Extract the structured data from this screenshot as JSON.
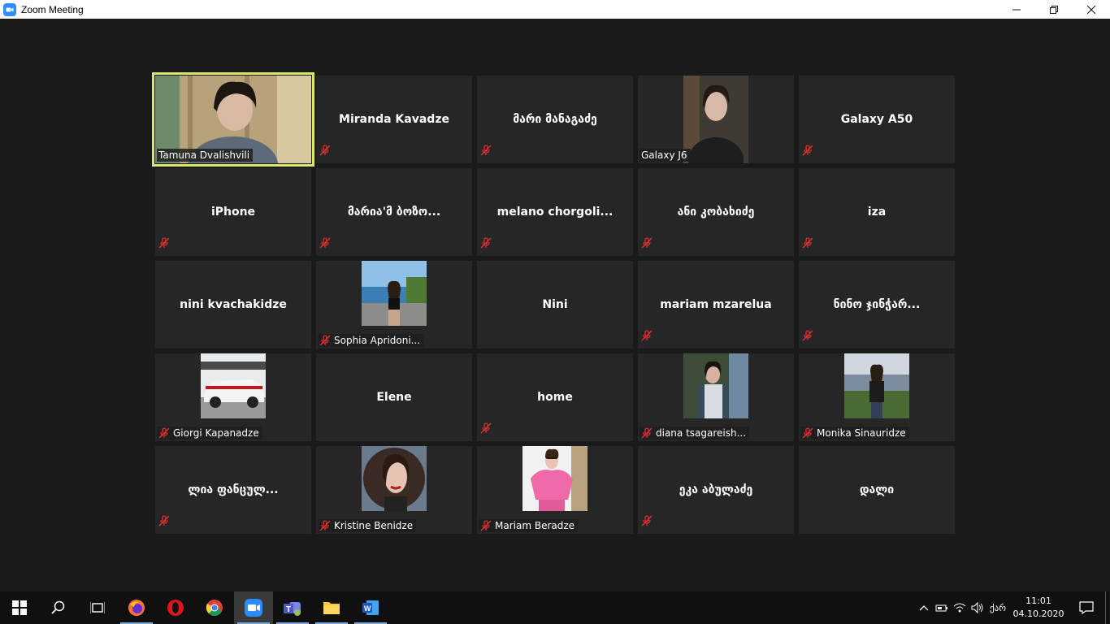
{
  "window": {
    "title": "Zoom Meeting",
    "minimize": "—",
    "restore": "❐",
    "close": "✕"
  },
  "colors": {
    "active_speaker_border": "#d9e86b",
    "tile_bg": "#262626",
    "mute_icon": "#e02f2f",
    "zoom_blue": "#2d8cff"
  },
  "participants": [
    {
      "name": "Tamuna Dvalishvili",
      "video": true,
      "active_speaker": true,
      "muted": false
    },
    {
      "name": "Miranda Kavadze",
      "video": false,
      "muted": true
    },
    {
      "name": "მარი მანაგაძე",
      "video": false,
      "muted": true
    },
    {
      "name": "Galaxy J6",
      "video": true,
      "muted": false
    },
    {
      "name": "Galaxy A50",
      "video": false,
      "muted": true
    },
    {
      "name": "iPhone",
      "video": false,
      "muted": true
    },
    {
      "name": "მარია'მ ბოზო...",
      "video": false,
      "muted": true
    },
    {
      "name": "melano  chorgoli...",
      "video": false,
      "muted": true
    },
    {
      "name": "ანი კობახიძე",
      "video": false,
      "muted": true
    },
    {
      "name": "iza",
      "video": false,
      "muted": true
    },
    {
      "name": "nini kvachakidze",
      "video": false,
      "muted": false
    },
    {
      "name": "Sophia Apridoni...",
      "video": true,
      "muted": true
    },
    {
      "name": "Nini",
      "video": false,
      "muted": false
    },
    {
      "name": "mariam mzarelua",
      "video": false,
      "muted": true
    },
    {
      "name": "ნინო ჯინჭარ...",
      "video": false,
      "muted": true
    },
    {
      "name": "Giorgi Kapanadze",
      "video": true,
      "muted": true
    },
    {
      "name": "Elene",
      "video": false,
      "muted": false
    },
    {
      "name": "home",
      "video": false,
      "muted": true
    },
    {
      "name": "diana tsagareish...",
      "video": true,
      "muted": true
    },
    {
      "name": "Monika Sinauridze",
      "video": true,
      "muted": true
    },
    {
      "name": "ლია ფანცულ...",
      "video": false,
      "muted": true
    },
    {
      "name": "Kristine Benidze",
      "video": true,
      "muted": true
    },
    {
      "name": "Mariam Beradze",
      "video": true,
      "muted": true
    },
    {
      "name": "ეკა აბულაძე",
      "video": false,
      "muted": true
    },
    {
      "name": "დალი",
      "video": false,
      "muted": false
    }
  ],
  "taskbar": {
    "apps": [
      "windows-start",
      "search",
      "task-view",
      "firefox",
      "opera",
      "chrome",
      "zoom",
      "teams",
      "file-explorer",
      "word"
    ],
    "language": "ქარ",
    "time": "11:01",
    "date": "04.10.2020"
  }
}
